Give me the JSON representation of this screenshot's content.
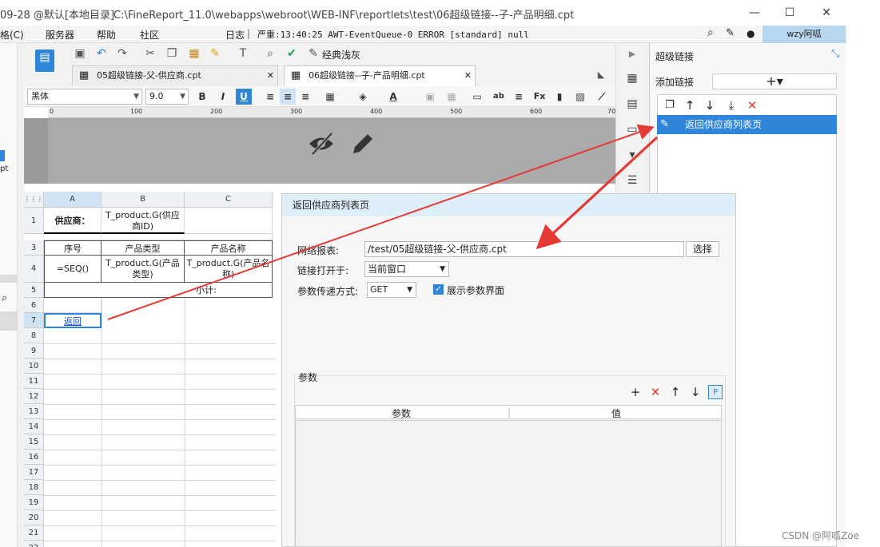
{
  "title_bar": {
    "left_fragment": "09-28 @默认[本地目录]",
    "path": "C:\\FineReport_11.0\\webapps\\webroot\\WEB-INF\\reportlets\\test\\06超级链接--子-产品明细.cpt",
    "minimize": "—",
    "maximize": "☐",
    "close": "✕"
  },
  "menu": {
    "left_fragment": "格(C)",
    "items": [
      "服务器",
      "帮助",
      "社区"
    ],
    "log": "日志",
    "log_status": "严重:13:40:25 AWT-EventQueue-0 ERROR [standard] null",
    "user": "wzy阿呱"
  },
  "left_strip": {
    "text1": "pt"
  },
  "toolbar": {
    "theme_label": "经典浅灰"
  },
  "tabs": [
    {
      "label": "05超级链接-父-供应商.cpt"
    },
    {
      "label": "06超级链接--子-产品明细.cpt"
    }
  ],
  "format": {
    "font": "黑体",
    "size": "9.0"
  },
  "ruler": {
    "ticks": [
      "0",
      "100",
      "200",
      "300",
      "400",
      "500",
      "600",
      "70"
    ]
  },
  "sheet": {
    "columns": [
      "A",
      "B",
      "C"
    ],
    "rows": [
      "1",
      "3",
      "4",
      "5",
      "6",
      "7",
      "8",
      "9",
      "10",
      "11",
      "12",
      "13",
      "14",
      "15",
      "16",
      "17",
      "18",
      "19",
      "20",
      "21",
      "22"
    ],
    "cells": {
      "a1": "供应商：",
      "b1": "T_product.G(供应商ID)",
      "a3": "序号",
      "b3": "产品类型",
      "c3": "产品名称",
      "a4": "=SEQ()",
      "b4": "T_product.G(产品类型)",
      "c4": "T_product.G(产品名称)",
      "c5": "小计:",
      "a7": "返回"
    }
  },
  "hyperlink_panel": {
    "title": "超级链接",
    "add_label": "添加链接",
    "add_button": "+▾",
    "selected_item": "返回供应商列表页"
  },
  "dialog": {
    "title": "返回供应商列表页",
    "report_label": "网络报表:",
    "report_value": "/test/05超级链接-父-供应商.cpt",
    "choose_button": "选择",
    "open_in_label": "链接打开于:",
    "open_in_value": "当前窗口",
    "method_label": "参数传递方式:",
    "method_value": "GET",
    "show_param_label": "展示参数界面",
    "params_label": "参数",
    "param_col": "参数",
    "value_col": "值"
  },
  "watermark": "CSDN @阿呱Zoe",
  "colors": {
    "accent": "#2f85d9",
    "arrow": "#e53935"
  }
}
